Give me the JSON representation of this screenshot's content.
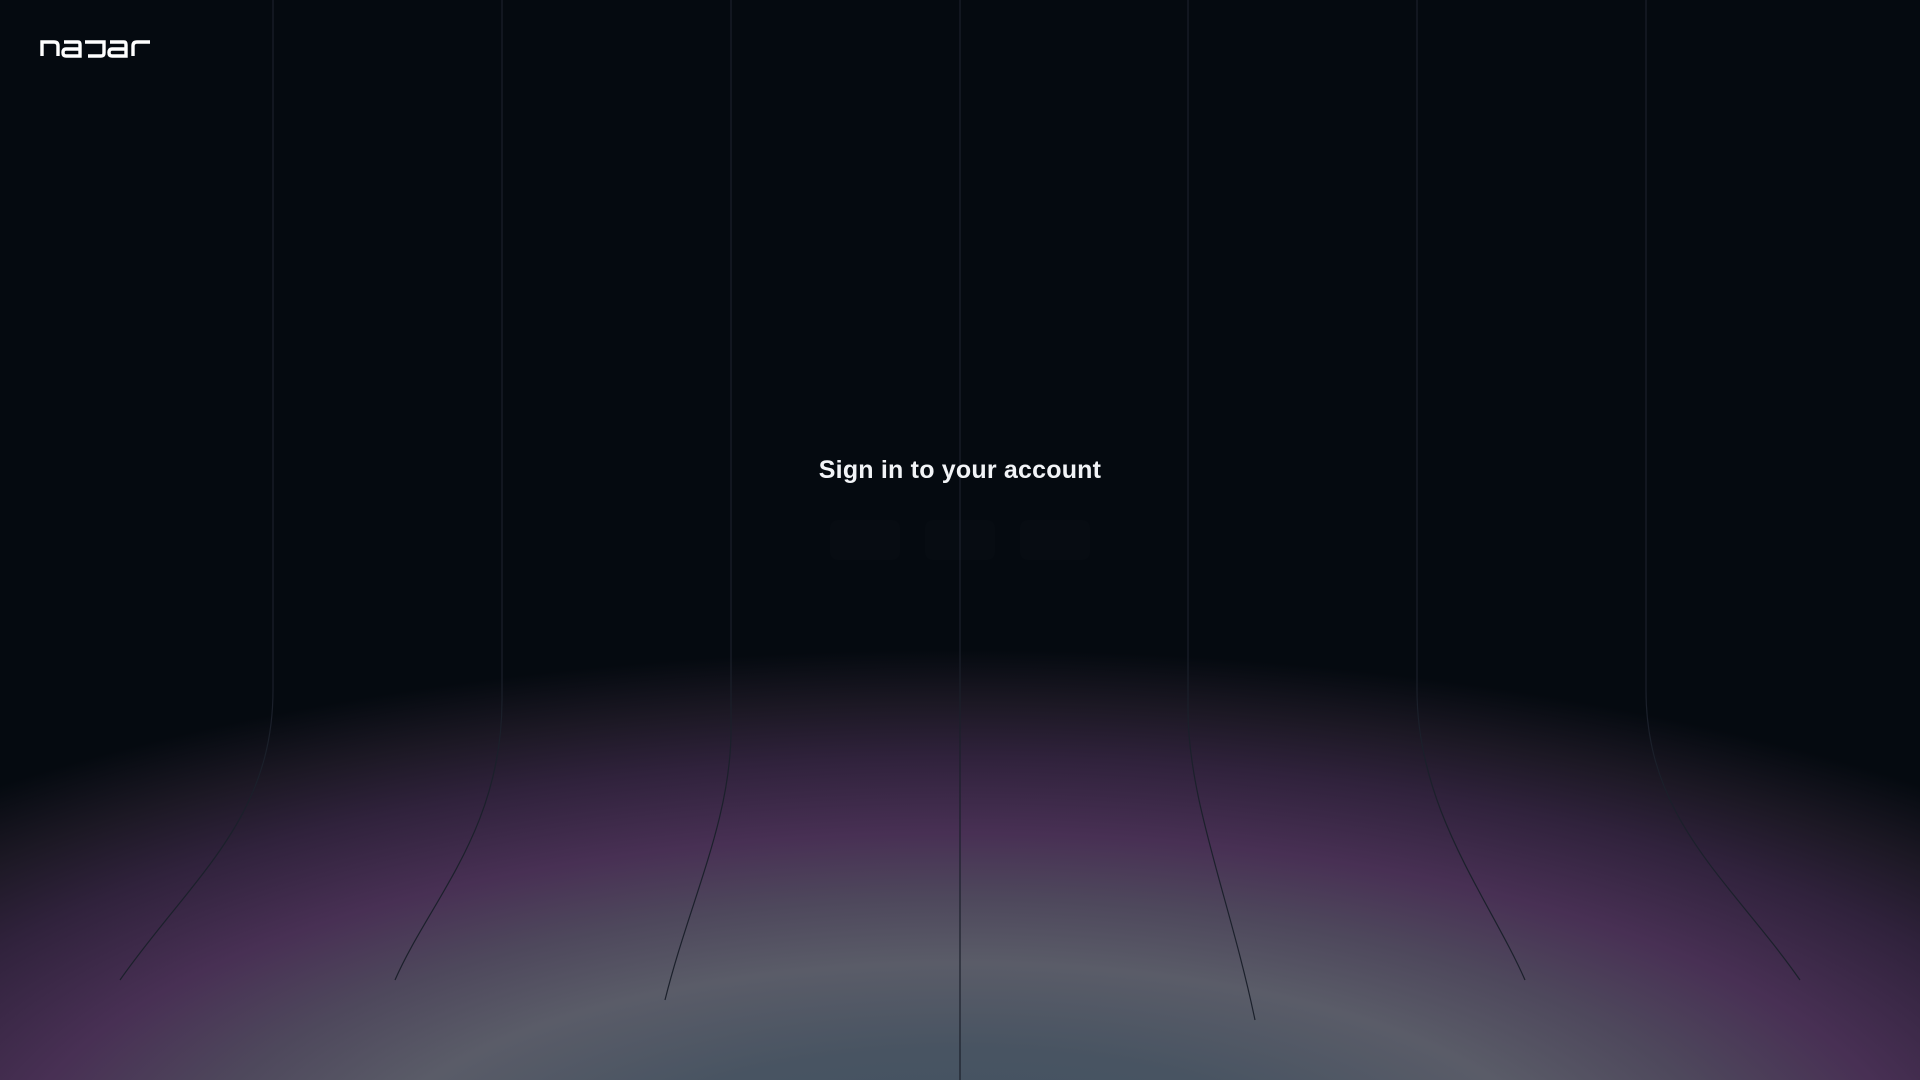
{
  "brand": {
    "logo_text": "najar",
    "logo_color": "#ffffff"
  },
  "auth": {
    "title": "Sign in to your account"
  },
  "theme": {
    "background": "#050a10",
    "glow_purple": "#48304f",
    "glow_gray": "#5a5c68",
    "line_color": "#1a1f29",
    "text_color": "#f2f4f7"
  }
}
